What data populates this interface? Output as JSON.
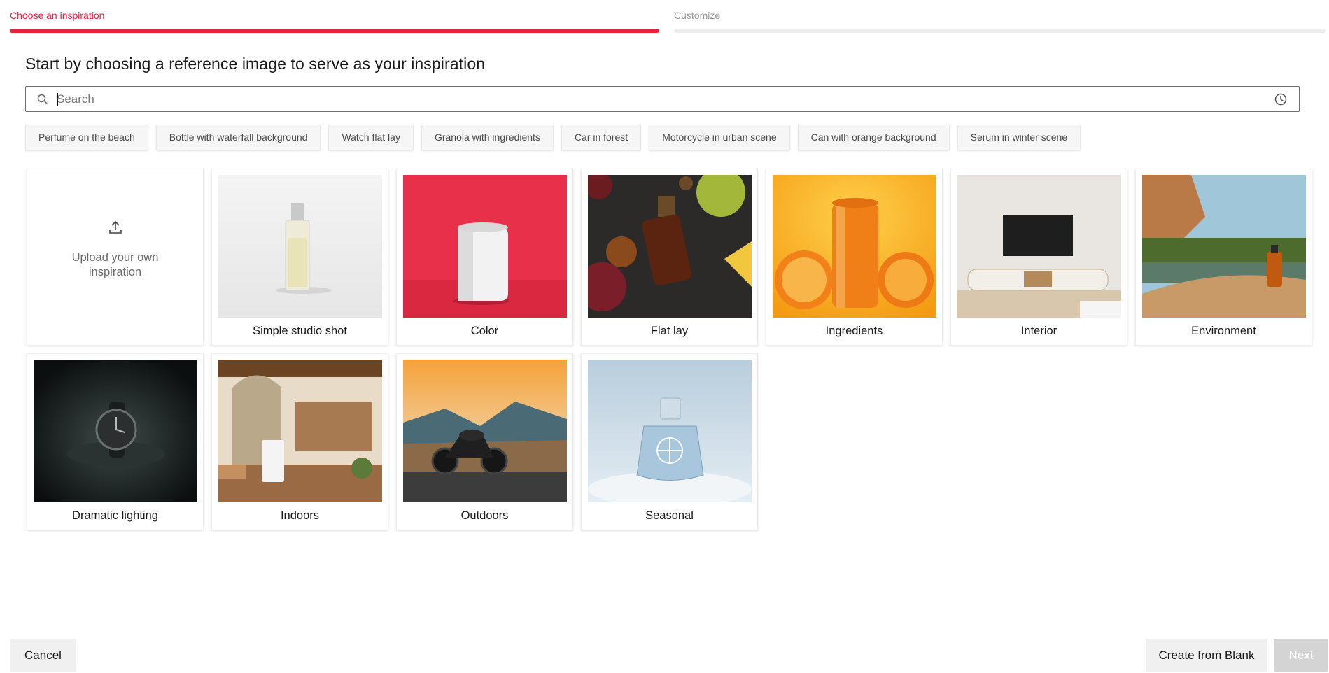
{
  "stepper": {
    "steps": [
      {
        "label": "Choose an inspiration",
        "active": true
      },
      {
        "label": "Customize",
        "active": false
      }
    ],
    "active_color": "#e8213f"
  },
  "heading": "Start by choosing a reference image to serve as your inspiration",
  "search": {
    "placeholder": "Search",
    "value": "",
    "icon": "search-icon",
    "history_icon": "clock-history-icon"
  },
  "chips": [
    "Perfume on the beach",
    "Bottle with waterfall background",
    "Watch flat lay",
    "Granola with ingredients",
    "Car in forest",
    "Motorcycle in urban scene",
    "Can with orange background",
    "Serum in winter scene"
  ],
  "upload": {
    "label": "Upload your own inspiration",
    "icon": "upload-icon"
  },
  "cards": [
    {
      "label": "Simple studio shot",
      "image": "perfume-bottle-studio"
    },
    {
      "label": "Color",
      "image": "white-can-red-background"
    },
    {
      "label": "Flat lay",
      "image": "bottle-flat-lay-food"
    },
    {
      "label": "Ingredients",
      "image": "orange-can-oranges"
    },
    {
      "label": "Interior",
      "image": "tv-living-room"
    },
    {
      "label": "Environment",
      "image": "bottle-desert-oasis"
    },
    {
      "label": "Dramatic lighting",
      "image": "watch-spotlight"
    },
    {
      "label": "Indoors",
      "image": "air-purifier-room"
    },
    {
      "label": "Outdoors",
      "image": "motorcycle-mountain-road"
    },
    {
      "label": "Seasonal",
      "image": "perfume-snow"
    }
  ],
  "footer": {
    "cancel": "Cancel",
    "create_blank": "Create from Blank",
    "next": "Next"
  }
}
